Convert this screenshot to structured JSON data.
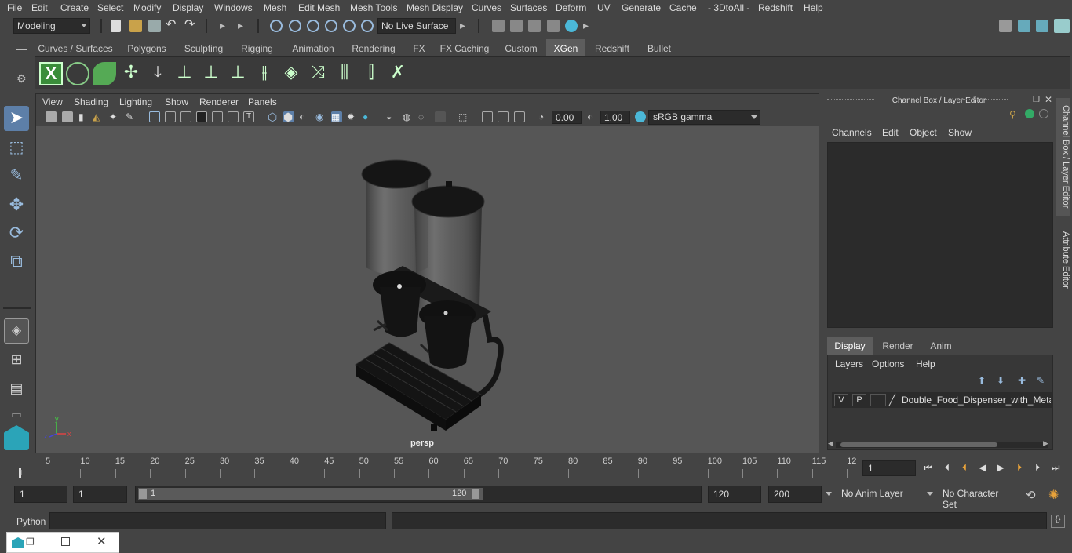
{
  "menubar": {
    "items": [
      "File",
      "Edit",
      "Create",
      "Select",
      "Modify",
      "Display",
      "Windows",
      "Mesh",
      "Edit Mesh",
      "Mesh Tools",
      "Mesh Display",
      "Curves",
      "Surfaces",
      "Deform",
      "UV",
      "Generate",
      "Cache",
      "- 3DtoAll -",
      "Redshift",
      "Help"
    ]
  },
  "statusline": {
    "mode": "Modeling",
    "live_surface": "No Live Surface"
  },
  "shelf": {
    "tabs": [
      "Curves / Surfaces",
      "Polygons",
      "Sculpting",
      "Rigging",
      "Animation",
      "Rendering",
      "FX",
      "FX Caching",
      "Custom",
      "XGen",
      "Redshift",
      "Bullet"
    ],
    "active_tab": "XGen"
  },
  "viewport": {
    "menu": [
      "View",
      "Shading",
      "Lighting",
      "Show",
      "Renderer",
      "Panels"
    ],
    "exposure": "0.00",
    "gamma": "1.00",
    "colorspace": "sRGB gamma",
    "camera_label": "persp",
    "axis_x": "x",
    "axis_y": "y",
    "axis_z": "z"
  },
  "channelbox": {
    "title": "Channel Box / Layer Editor",
    "menu": [
      "Channels",
      "Edit",
      "Object",
      "Show"
    ],
    "layer_tabs": [
      "Display",
      "Render",
      "Anim"
    ],
    "active_layer_tab": "Display",
    "layer_menu": [
      "Layers",
      "Options",
      "Help"
    ],
    "layer": {
      "v": "V",
      "p": "P",
      "name": "Double_Food_Dispenser_with_Metal"
    },
    "side_tabs": [
      "Channel Box / Layer Editor",
      "Attribute Editor"
    ]
  },
  "timeline": {
    "ticks": [
      "5",
      "10",
      "15",
      "20",
      "25",
      "30",
      "35",
      "40",
      "45",
      "50",
      "55",
      "60",
      "65",
      "70",
      "75",
      "80",
      "85",
      "90",
      "95",
      "100",
      "105",
      "110",
      "115",
      "12"
    ],
    "current_marker": "1",
    "current_frame": "1"
  },
  "range": {
    "start": "1",
    "inner_start": "1",
    "slider_start": "1",
    "slider_end": "120",
    "end": "120",
    "max_end": "200",
    "anim_layer": "No Anim Layer",
    "character_set": "No Character Set"
  },
  "cmdline": {
    "language": "Python"
  }
}
